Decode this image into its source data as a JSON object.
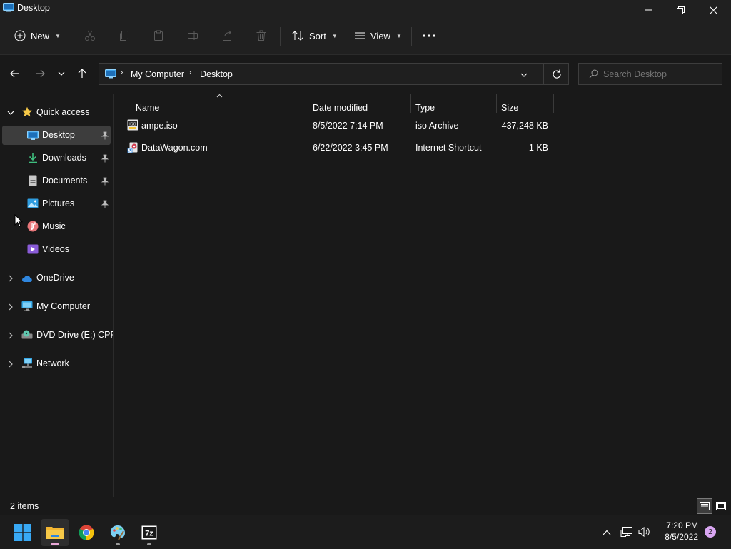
{
  "window": {
    "title": "Desktop"
  },
  "toolbar": {
    "new_label": "New",
    "sort_label": "Sort",
    "view_label": "View"
  },
  "address": {
    "segments": [
      "My Computer",
      "Desktop"
    ]
  },
  "search": {
    "placeholder": "Search Desktop"
  },
  "sidebar": {
    "quick_access": "Quick access",
    "items": [
      "Desktop",
      "Downloads",
      "Documents",
      "Pictures",
      "Music",
      "Videos"
    ],
    "roots": [
      "OneDrive",
      "My Computer",
      "DVD Drive (E:) CPRA",
      "Network"
    ]
  },
  "columns": {
    "name": "Name",
    "date": "Date modified",
    "type": "Type",
    "size": "Size"
  },
  "files": [
    {
      "name": "ampe.iso",
      "date": "8/5/2022 7:14 PM",
      "type": "iso Archive",
      "size": "437,248 KB",
      "icon": "iso-file-icon"
    },
    {
      "name": "DataWagon.com",
      "date": "6/22/2022 3:45 PM",
      "type": "Internet Shortcut",
      "size": "1 KB",
      "icon": "shortcut-file-icon"
    }
  ],
  "status": {
    "item_count": "2 items"
  },
  "taskbar": {
    "time": "7:20 PM",
    "date": "8/5/2022",
    "notification_count": "2"
  },
  "colors": {
    "selection": "#3d3d3d",
    "accent_blue": "#4cc2ff",
    "folder_yellow": "#f7c948",
    "notify_badge": "#d9a6f2"
  }
}
